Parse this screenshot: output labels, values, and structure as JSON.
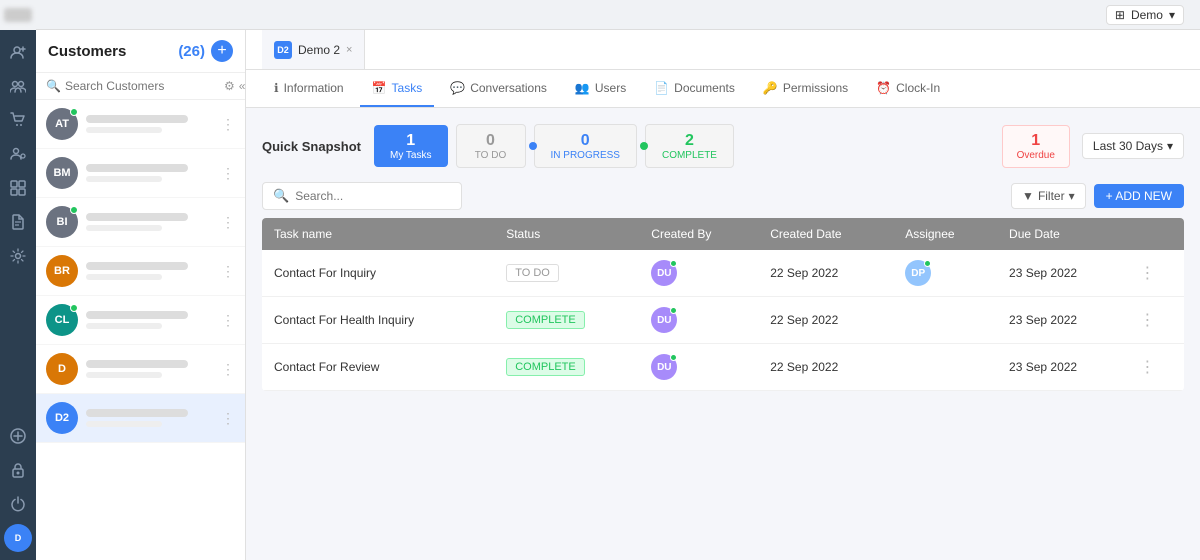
{
  "app": {
    "name": "Demo",
    "logo_alt": "logo"
  },
  "global_top_bar": {
    "app_switcher_label": "Demo",
    "grid_icon": "⊞"
  },
  "sidebar": {
    "title": "Customers",
    "count": "(26)",
    "add_button_label": "+",
    "search_placeholder": "Search Customers",
    "customers": [
      {
        "initials": "AT",
        "color": "#6b7280",
        "has_dot": true
      },
      {
        "initials": "BM",
        "color": "#6b7280",
        "has_dot": false
      },
      {
        "initials": "BI",
        "color": "#6b7280",
        "has_dot": true
      },
      {
        "initials": "BR",
        "color": "#d97706",
        "has_dot": false
      },
      {
        "initials": "CL",
        "color": "#0d9488",
        "has_dot": true
      },
      {
        "initials": "D",
        "color": "#d97706",
        "has_dot": false
      },
      {
        "initials": "D2",
        "color": "#3b82f6",
        "has_dot": false,
        "active": true
      }
    ]
  },
  "tab": {
    "icon": "D2",
    "label": "Demo 2",
    "close": "×"
  },
  "nav_tabs": [
    {
      "id": "information",
      "label": "Information",
      "icon": "ℹ",
      "active": false
    },
    {
      "id": "tasks",
      "label": "Tasks",
      "icon": "📅",
      "active": true
    },
    {
      "id": "conversations",
      "label": "Conversations",
      "icon": "💬",
      "active": false
    },
    {
      "id": "users",
      "label": "Users",
      "icon": "👥",
      "active": false
    },
    {
      "id": "documents",
      "label": "Documents",
      "icon": "📄",
      "active": false
    },
    {
      "id": "permissions",
      "label": "Permissions",
      "icon": "🔑",
      "active": false
    },
    {
      "id": "clock-in",
      "label": "Clock-In",
      "icon": "⏰",
      "active": false
    }
  ],
  "quick_snapshot": {
    "label": "Quick Snapshot",
    "my_tasks": {
      "count": "1",
      "label": "My Tasks"
    },
    "todo": {
      "count": "0",
      "label": "TO DO"
    },
    "in_progress": {
      "count": "0",
      "label": "IN PROGRESS"
    },
    "complete": {
      "count": "2",
      "label": "COMPLETE"
    },
    "overdue": {
      "count": "1",
      "label": "Overdue"
    },
    "date_range": "Last 30 Days",
    "date_range_icon": "▾"
  },
  "table": {
    "search_placeholder": "Search...",
    "filter_label": "Filter",
    "add_new_label": "+ ADD NEW",
    "columns": [
      {
        "id": "task_name",
        "label": "Task name"
      },
      {
        "id": "status",
        "label": "Status"
      },
      {
        "id": "created_by",
        "label": "Created By"
      },
      {
        "id": "created_date",
        "label": "Created Date"
      },
      {
        "id": "assignee",
        "label": "Assignee"
      },
      {
        "id": "due_date",
        "label": "Due Date"
      }
    ],
    "rows": [
      {
        "task_name": "Contact For Inquiry",
        "status": "TO DO",
        "status_type": "todo",
        "created_by_initials": "DU",
        "created_by_color": "#a78bfa",
        "created_date": "22 Sep 2022",
        "assignee_initials": "DP",
        "assignee_color": "#93c5fd",
        "due_date": "23 Sep 2022"
      },
      {
        "task_name": "Contact For Health Inquiry",
        "status": "COMPLETE",
        "status_type": "complete",
        "created_by_initials": "DU",
        "created_by_color": "#a78bfa",
        "created_date": "22 Sep 2022",
        "assignee_initials": "",
        "assignee_color": "",
        "due_date": "23 Sep 2022"
      },
      {
        "task_name": "Contact For Review",
        "status": "COMPLETE",
        "status_type": "complete",
        "created_by_initials": "DU",
        "created_by_color": "#a78bfa",
        "created_date": "22 Sep 2022",
        "assignee_initials": "",
        "assignee_color": "",
        "due_date": "23 Sep 2022"
      }
    ]
  },
  "nav_icons": [
    {
      "id": "add-contact",
      "icon": "👤+",
      "unicode": "⊕"
    },
    {
      "id": "groups",
      "icon": "👥"
    },
    {
      "id": "cart",
      "icon": "🛒"
    },
    {
      "id": "people-settings",
      "icon": "👥⚙"
    },
    {
      "id": "modules",
      "icon": "⊞"
    },
    {
      "id": "documents",
      "icon": "📄"
    },
    {
      "id": "settings",
      "icon": "⚙"
    },
    {
      "id": "add-plus",
      "icon": "+"
    },
    {
      "id": "lock",
      "icon": "🔒"
    },
    {
      "id": "power",
      "icon": "⏻"
    }
  ]
}
